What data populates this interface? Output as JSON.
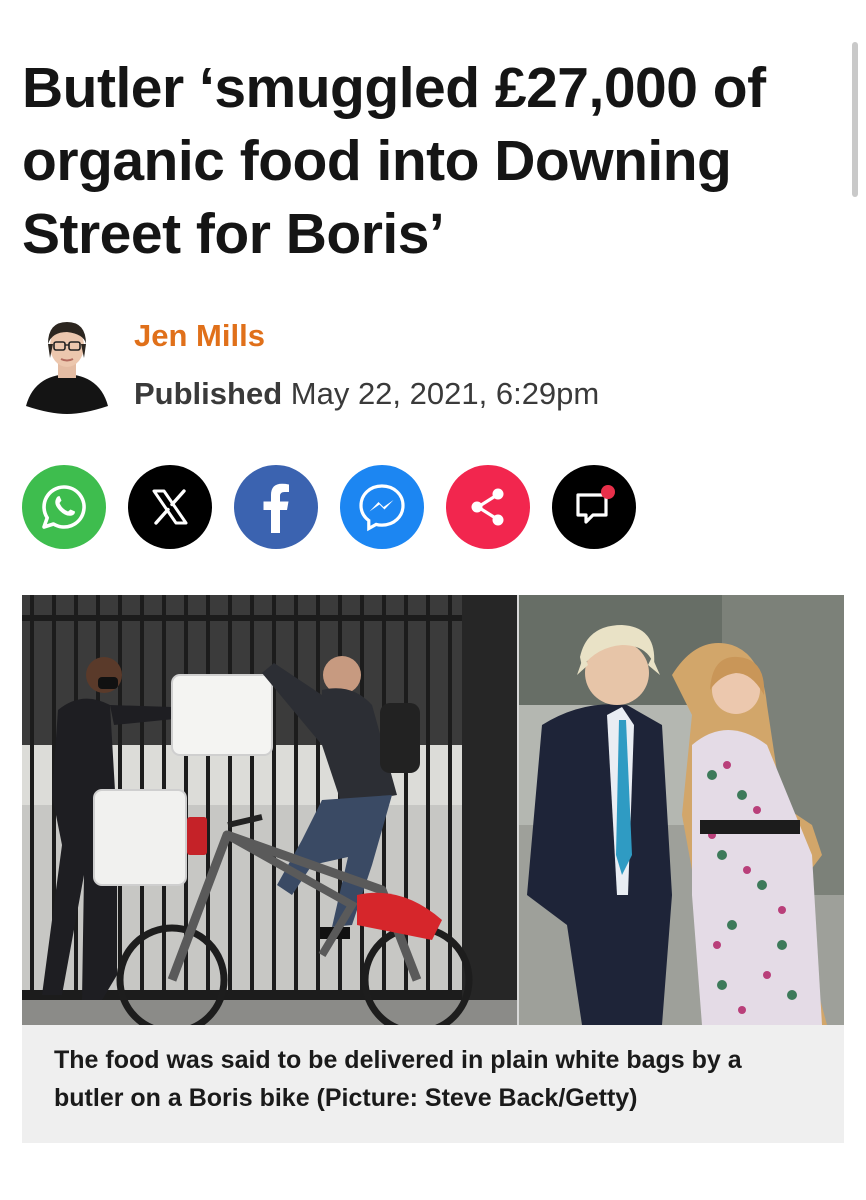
{
  "article": {
    "headline": "Butler ‘smuggled £27,000 of organic food into Downing Street for Boris’",
    "author": "Jen Mills",
    "published_label": "Published",
    "published_date": "May 22, 2021, 6:29pm",
    "caption": "The food was said to be delivered in plain white bags by a butler on a Boris bike (Picture: Steve Back/Getty)"
  },
  "share": [
    {
      "name": "whatsapp",
      "icon": "whatsapp-icon",
      "color": "#3ebd4e"
    },
    {
      "name": "x",
      "icon": "x-icon",
      "color": "#000000"
    },
    {
      "name": "facebook",
      "icon": "facebook-icon",
      "color": "#3b63b0"
    },
    {
      "name": "messenger",
      "icon": "messenger-icon",
      "color": "#1c86f2"
    },
    {
      "name": "share",
      "icon": "share-icon",
      "color": "#f2264e"
    },
    {
      "name": "comments",
      "icon": "comment-icon",
      "color": "#000000"
    }
  ],
  "colors": {
    "author": "#e0701a",
    "caption_bg": "#efefef",
    "notification_dot": "#e8304a"
  }
}
